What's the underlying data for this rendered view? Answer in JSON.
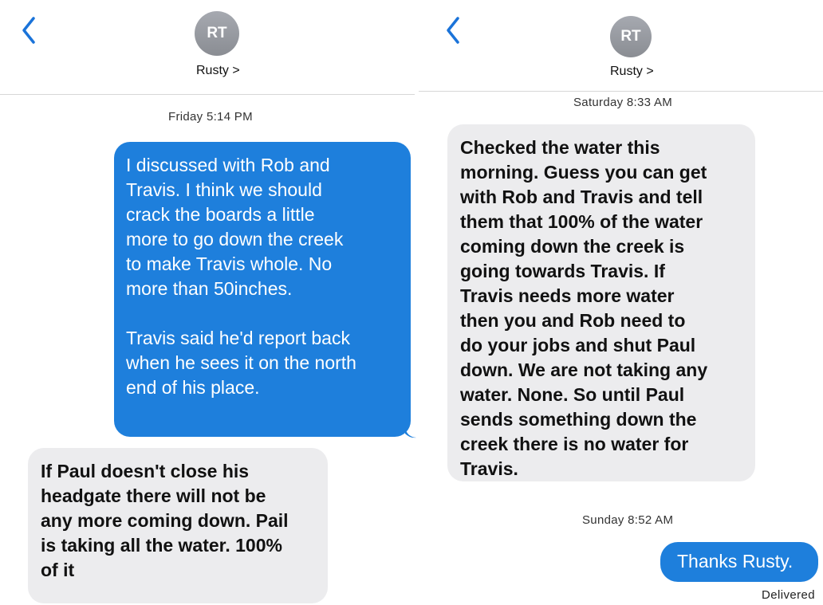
{
  "left": {
    "back_icon": "chevron-left-icon",
    "avatar_initials": "RT",
    "contact_name": "Rusty >",
    "timestamp": "Friday 5:14 PM",
    "messages": [
      {
        "type": "sent",
        "text": "I discussed with Rob and\nTravis. I think we should\ncrack the boards a little\nmore to go down the creek\nto make Travis whole. No\nmore than 50inches.\n\nTravis said he'd report back\nwhen he sees it on the north\nend of his place."
      },
      {
        "type": "received",
        "text": "If Paul doesn't close his\nheadgate there will not be\nany more coming down. Pail\nis taking all the water. 100%\nof it"
      }
    ]
  },
  "right": {
    "back_icon": "chevron-left-icon",
    "avatar_initials": "RT",
    "contact_name": "Rusty >",
    "timestamp_1": "Saturday 8:33 AM",
    "messages": [
      {
        "type": "received",
        "text": "Checked the water this\nmorning. Guess you can get\nwith Rob and Travis and tell\nthem that 100% of the water\ncoming down the creek is\ngoing towards Travis. If\nTravis needs more water\nthen you and Rob need to\ndo your jobs and shut Paul\ndown. We are not taking any\nwater. None. So until Paul\nsends something down the\ncreek there is no water for\nTravis."
      },
      {
        "type": "sent",
        "text": "Thanks Rusty."
      }
    ],
    "timestamp_2": "Sunday 8:52 AM",
    "delivered_label": "Delivered"
  },
  "colors": {
    "sent_bubble": "#1e7fdc",
    "received_bubble": "#ececee",
    "accent": "#1a73d9"
  }
}
